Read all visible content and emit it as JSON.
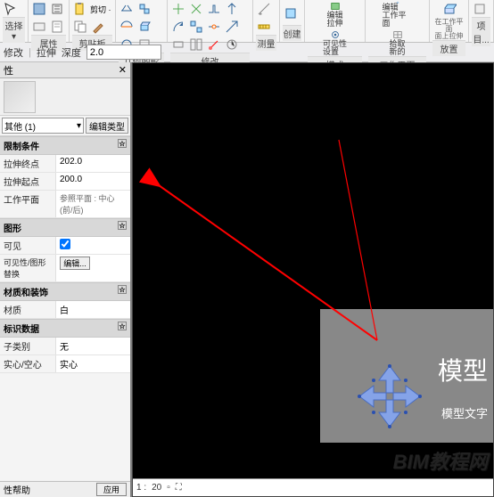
{
  "ribbon": {
    "groups": [
      {
        "label": "选择 ▾",
        "icons": [
          "modify"
        ]
      },
      {
        "label": "属性",
        "icons": [
          "p1",
          "p2",
          "p3",
          "p4"
        ]
      },
      {
        "label": "剪贴板",
        "icons": [
          "cut",
          "copy",
          "paste",
          "match"
        ],
        "cut_label": "剪切 ·"
      },
      {
        "label": "几何图形",
        "icons": [
          "g1",
          "g2",
          "g3",
          "g4",
          "g5",
          "g6"
        ]
      },
      {
        "label": "修改",
        "icons": [
          "m1",
          "m2",
          "m3",
          "m4",
          "m5",
          "m6",
          "m7",
          "m8",
          "m9",
          "m10",
          "m11",
          "m12"
        ]
      },
      {
        "label": "测量",
        "icons": [
          "meas1",
          "meas2"
        ]
      },
      {
        "label": "创建",
        "icons": [
          "create1"
        ]
      },
      {
        "label": "模式",
        "buttons": [
          {
            "label": "编辑\n拉伸"
          },
          {
            "label": "可见性\n设置"
          }
        ]
      },
      {
        "label": "工作平面",
        "buttons": [
          {
            "label": "编辑\n工作平面"
          },
          {
            "label": "拾取\n新的"
          }
        ]
      },
      {
        "label": "放置",
        "icons": [
          "place1"
        ],
        "extra": "在工作平面\n面上拉伸"
      },
      {
        "label": "项目...",
        "icons": [
          "proj1"
        ]
      }
    ]
  },
  "optionsbar": {
    "modify_label": "修改",
    "extrude_label": "拉伸",
    "depth_label": "深度",
    "depth_value": "2.0"
  },
  "properties": {
    "title": "性",
    "selector_text": "其他 (1)",
    "edit_type_btn": "编辑类型",
    "groups": [
      {
        "head": "限制条件",
        "rows": [
          {
            "k": "拉伸终点",
            "v": "202.0"
          },
          {
            "k": "拉伸起点",
            "v": "200.0"
          },
          {
            "k": "工作平面",
            "v": "参照平面 : 中心(前/后)"
          }
        ]
      },
      {
        "head": "图形",
        "rows": [
          {
            "k": "可见",
            "v": "",
            "chk": true
          },
          {
            "k": "可见性/图形替换",
            "v": "",
            "btn": "编辑..."
          }
        ]
      },
      {
        "head": "材质和装饰",
        "rows": [
          {
            "k": "材质",
            "v": "白"
          }
        ]
      },
      {
        "head": "标识数据",
        "rows": [
          {
            "k": "子类别",
            "v": "无"
          },
          {
            "k": "实心/空心",
            "v": "实心"
          }
        ]
      }
    ],
    "apply_label": "性帮助",
    "apply_btn": "应用"
  },
  "viewport": {
    "overlay_title": "模型",
    "overlay_sub": "模型文字",
    "watermark": "BIM教程网",
    "scale_label": "20"
  }
}
